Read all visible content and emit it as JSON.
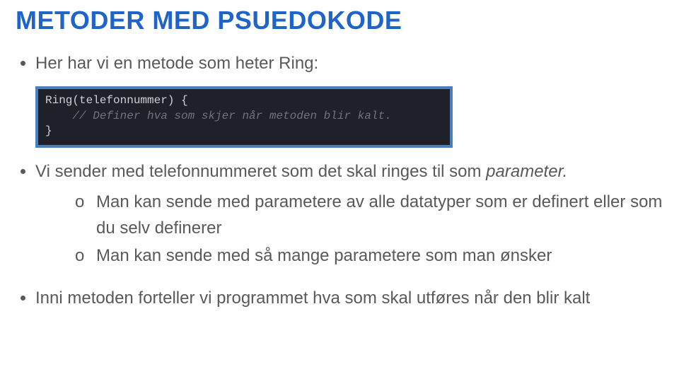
{
  "title": {
    "strong": "METODER",
    "rest": "MED PSUEDOKODE"
  },
  "bullets": {
    "b1": "Her har vi en metode som heter Ring:",
    "b2a": "Vi sender med telefonnummeret som det skal ringes til som ",
    "b2_em": "parameter.",
    "b3": "Inni metoden forteller vi programmet hva som skal utføres når den blir kalt"
  },
  "sub": {
    "marker": "o",
    "s1": "Man kan sende med parametere av alle datatyper som er definert eller som du selv definerer",
    "s2": "Man kan sende med så mange parametere som man ønsker"
  },
  "code": {
    "line1": "Ring(telefonnummer) {",
    "line2_indent": "    ",
    "line2_comment": "// Definer hva som skjer når metoden blir kalt.",
    "line3": "}"
  }
}
